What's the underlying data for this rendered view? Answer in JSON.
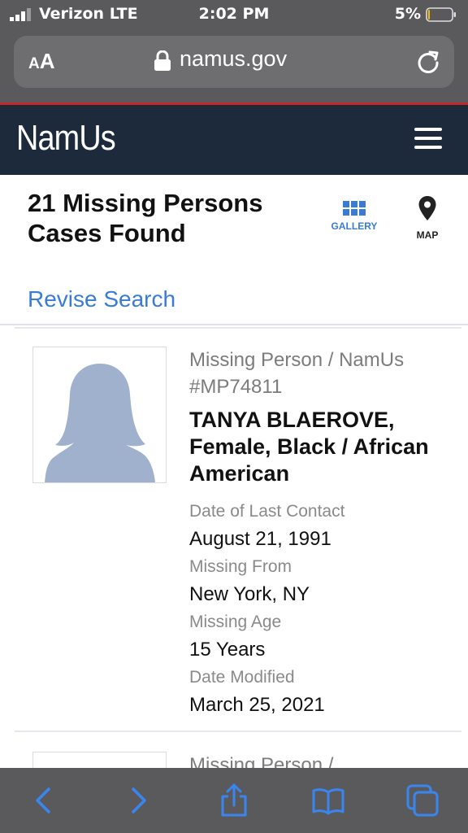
{
  "status_bar": {
    "carrier": "Verizon LTE",
    "time": "2:02 PM",
    "battery_percent": "5%",
    "battery_level": 0.05
  },
  "browser": {
    "text_size_label_small": "A",
    "text_size_label_large": "A",
    "domain": "namus.gov"
  },
  "header": {
    "logo_text": "NamUs"
  },
  "results": {
    "count_text": "21 Missing Persons Cases Found",
    "revise_label": "Revise Search",
    "views": {
      "gallery_label": "GALLERY",
      "map_label": "MAP"
    }
  },
  "cases": [
    {
      "type_line": "Missing Person / NamUs #MP74811",
      "name_line": "TANYA BLAEROVE, Female, Black / African American",
      "fields": {
        "last_contact_label": "Date of Last Contact",
        "last_contact_value": "August 21, 1991",
        "missing_from_label": "Missing From",
        "missing_from_value": "New York, NY",
        "missing_age_label": "Missing Age",
        "missing_age_value": "15 Years",
        "date_modified_label": "Date Modified",
        "date_modified_value": "March 25, 2021"
      }
    },
    {
      "type_line": "Missing Person /"
    }
  ],
  "colors": {
    "header_bg": "#1c2a3b",
    "accent_blue": "#3a7bd5",
    "browser_chrome": "#5a5a5c",
    "header_stripe": "#c0282d",
    "silhouette": "#9fb1cc"
  }
}
